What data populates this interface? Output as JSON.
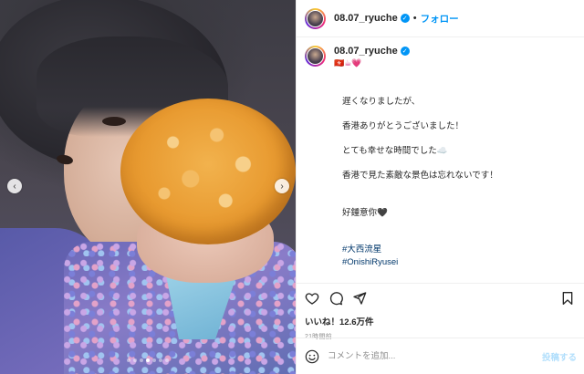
{
  "header": {
    "username": "08.07_ryuche",
    "separator": "•",
    "follow_label": "フォロー"
  },
  "caption": {
    "username": "08.07_ryuche",
    "emoji_line": "🇭🇰☕💗",
    "lines": [
      "遅くなりましたが、",
      "香港ありがとうございました！",
      "とても幸せな時間でした☁️",
      "香港で見た素敵な景色は忘れないです！",
      "好鍾意你🖤",
      "#大西流星",
      "#OnishiRyusei"
    ]
  },
  "media": {
    "prev_glyph": "‹",
    "next_glyph": "›",
    "dot_count": 7,
    "active_dot": 3
  },
  "engagement": {
    "likes": "いいね！12.6万件",
    "time_ago": "21時間前"
  },
  "comment": {
    "placeholder": "コメントを追加...",
    "post_label": "投稿する"
  },
  "colors": {
    "accent": "#0095f6",
    "hashtag": "#00376b",
    "post_disabled": "#b2dffc"
  }
}
